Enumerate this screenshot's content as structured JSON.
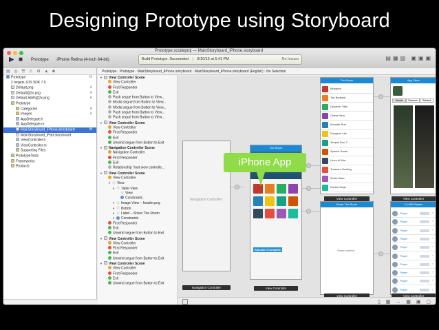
{
  "slide": {
    "title": "Designing Prototype using Storyboard"
  },
  "toolbar": {
    "run_icon": "play-icon",
    "stop_icon": "stop-icon",
    "scheme_target": "Prototype",
    "scheme_device": "iPhone Retina (4-inch 64-bit)",
    "activity_status": "Build Prototype: Succeeded",
    "activity_time": "9/10/13 at 5:41 PM",
    "activity_issues": "No Issues",
    "window_title": "Prototype.xcodeproj — MainStoryboard_iPhone.storyboard"
  },
  "jump_bar": {
    "crumbs": [
      "Prototype",
      "Prototype",
      "MainStoryboard_iPhone.storyboard",
      "MainStoryboard_iPhone.storyboard (English)",
      "No Selection"
    ]
  },
  "navigator": {
    "files": [
      {
        "label": "Prototype",
        "indent": 0,
        "badge": "M",
        "icon_color": "#4d8fe0",
        "selected": false
      },
      {
        "label": "2 targets, iOS SDK 7.0",
        "indent": 1,
        "badge": "",
        "icon_color": "",
        "selected": false
      },
      {
        "label": "Default.png",
        "indent": 1,
        "badge": "A",
        "icon_color": "#d9d9d9",
        "selected": false
      },
      {
        "label": "Default@2x.png",
        "indent": 1,
        "badge": "A",
        "icon_color": "#d9d9d9",
        "selected": false
      },
      {
        "label": "Default-568h@2x.png",
        "indent": 1,
        "badge": "A",
        "icon_color": "#d9d9d9",
        "selected": false
      },
      {
        "label": "Prototype",
        "indent": 1,
        "badge": "",
        "icon_color": "#e8c35a",
        "selected": false
      },
      {
        "label": "Categories",
        "indent": 2,
        "badge": "A",
        "icon_color": "#e8c35a",
        "selected": false
      },
      {
        "label": "Images",
        "indent": 2,
        "badge": "A",
        "icon_color": "#e8c35a",
        "selected": false
      },
      {
        "label": "AppDelegate.h",
        "indent": 2,
        "badge": "",
        "icon_color": "#b3c7e6",
        "selected": false
      },
      {
        "label": "AppDelegate.m",
        "indent": 2,
        "badge": "",
        "icon_color": "#b3c7e6",
        "selected": false
      },
      {
        "label": "MainStoryboard_iPhone.storyboard",
        "indent": 2,
        "badge": "M",
        "icon_color": "#f2f2f2",
        "selected": true
      },
      {
        "label": "MainStoryboard_iPad.storyboard",
        "indent": 2,
        "badge": "",
        "icon_color": "#f2f2f2",
        "selected": false
      },
      {
        "label": "ViewController.h",
        "indent": 2,
        "badge": "",
        "icon_color": "#b3c7e6",
        "selected": false
      },
      {
        "label": "ViewController.m",
        "indent": 2,
        "badge": "",
        "icon_color": "#b3c7e6",
        "selected": false
      },
      {
        "label": "Supporting Files",
        "indent": 2,
        "badge": "",
        "icon_color": "#e8c35a",
        "selected": false
      },
      {
        "label": "PrototypeTests",
        "indent": 1,
        "badge": "",
        "icon_color": "#e8c35a",
        "selected": false
      },
      {
        "label": "Frameworks",
        "indent": 1,
        "badge": "",
        "icon_color": "#e8c35a",
        "selected": false
      },
      {
        "label": "Products",
        "indent": 1,
        "badge": "",
        "icon_color": "#e8c35a",
        "selected": false
      }
    ]
  },
  "outline": {
    "rows": [
      {
        "label": "View Controller Scene",
        "indent": 0,
        "scene": true,
        "icon_color": ""
      },
      {
        "label": "View Controller",
        "indent": 1,
        "scene": false,
        "icon_color": "#f0a030"
      },
      {
        "label": "First Responder",
        "indent": 1,
        "scene": false,
        "icon_color": "#e84d3d"
      },
      {
        "label": "Exit",
        "indent": 1,
        "scene": false,
        "icon_color": "#4cb84c"
      },
      {
        "label": "Push segue from Button to View...",
        "indent": 1,
        "scene": false,
        "icon_color": "#b0b0b0"
      },
      {
        "label": "Modal segue from Button to View...",
        "indent": 1,
        "scene": false,
        "icon_color": "#b0b0b0"
      },
      {
        "label": "Modal segue from Button to View...",
        "indent": 1,
        "scene": false,
        "icon_color": "#b0b0b0"
      },
      {
        "label": "Push segue from Button to View...",
        "indent": 1,
        "scene": false,
        "icon_color": "#b0b0b0"
      },
      {
        "label": "Push segue from Button to View...",
        "indent": 1,
        "scene": false,
        "icon_color": "#b0b0b0"
      },
      {
        "label": "View Controller Scene",
        "indent": 0,
        "scene": true,
        "icon_color": ""
      },
      {
        "label": "View Controller",
        "indent": 1,
        "scene": false,
        "icon_color": "#f0a030"
      },
      {
        "label": "First Responder",
        "indent": 1,
        "scene": false,
        "icon_color": "#e84d3d"
      },
      {
        "label": "Exit",
        "indent": 1,
        "scene": false,
        "icon_color": "#4cb84c"
      },
      {
        "label": "Unwind segue from Button to Exit",
        "indent": 1,
        "scene": false,
        "icon_color": "#4cb84c"
      },
      {
        "label": "Navigation Controller Scene",
        "indent": 0,
        "scene": true,
        "icon_color": ""
      },
      {
        "label": "Navigation Controller",
        "indent": 1,
        "scene": false,
        "icon_color": "#f0a030"
      },
      {
        "label": "First Responder",
        "indent": 1,
        "scene": false,
        "icon_color": "#e84d3d"
      },
      {
        "label": "Exit",
        "indent": 1,
        "scene": false,
        "icon_color": "#4cb84c"
      },
      {
        "label": "Relationship \"root view controlle...",
        "indent": 1,
        "scene": false,
        "icon_color": "#b0b0b0"
      },
      {
        "label": "View Controller Scene",
        "indent": 0,
        "scene": true,
        "icon_color": ""
      },
      {
        "label": "View Controller",
        "indent": 1,
        "scene": false,
        "icon_color": "#f0a030"
      },
      {
        "label": "View",
        "indent": 2,
        "scene": false,
        "icon_color": "#e6e6e6"
      },
      {
        "label": "Table View",
        "indent": 3,
        "scene": false,
        "icon_color": "#e6e6e6"
      },
      {
        "label": "View",
        "indent": 4,
        "scene": false,
        "icon_color": "#e6e6e6"
      },
      {
        "label": "Constraints",
        "indent": 4,
        "scene": false,
        "icon_color": "#5b8fd6"
      },
      {
        "label": "Image View – header.png",
        "indent": 3,
        "scene": false,
        "icon_color": "#e6e6e6"
      },
      {
        "label": "Button",
        "indent": 3,
        "scene": false,
        "icon_color": "#e6e6e6"
      },
      {
        "label": "Label – Share The Room",
        "indent": 3,
        "scene": false,
        "icon_color": "#e6e6e6"
      },
      {
        "label": "Constraints",
        "indent": 3,
        "scene": false,
        "icon_color": "#5b8fd6"
      },
      {
        "label": "First Responder",
        "indent": 1,
        "scene": false,
        "icon_color": "#e84d3d"
      },
      {
        "label": "Exit",
        "indent": 1,
        "scene": false,
        "icon_color": "#4cb84c"
      },
      {
        "label": "Unwind segue from Button to Exit",
        "indent": 1,
        "scene": false,
        "icon_color": "#4cb84c"
      },
      {
        "label": "View Controller Scene",
        "indent": 0,
        "scene": true,
        "icon_color": ""
      },
      {
        "label": "View Controller",
        "indent": 1,
        "scene": false,
        "icon_color": "#f0a030"
      },
      {
        "label": "First Responder",
        "indent": 1,
        "scene": false,
        "icon_color": "#e84d3d"
      },
      {
        "label": "Exit",
        "indent": 1,
        "scene": false,
        "icon_color": "#4cb84c"
      },
      {
        "label": "Unwind segue from Button to Exit",
        "indent": 1,
        "scene": false,
        "icon_color": "#4cb84c"
      },
      {
        "label": "View Controller Scene",
        "indent": 0,
        "scene": true,
        "icon_color": ""
      },
      {
        "label": "View Controller",
        "indent": 1,
        "scene": false,
        "icon_color": "#f0a030"
      },
      {
        "label": "First Responder",
        "indent": 1,
        "scene": false,
        "icon_color": "#e84d3d"
      },
      {
        "label": "Exit",
        "indent": 1,
        "scene": false,
        "icon_color": "#4cb84c"
      },
      {
        "label": "Unwind segue from Button to Exit",
        "indent": 1,
        "scene": false,
        "icon_color": "#4cb84c"
      }
    ]
  },
  "canvas": {
    "callout": "iPhone App",
    "navigation_controller_label": "Navigation Controller",
    "scene_labels": {
      "nav": "Navigation Controller",
      "main": "View Controller",
      "top_list": "View Controller",
      "app_store": "View Controller",
      "share": "View Controller",
      "players": "View Controller"
    },
    "main_header": "The Room",
    "top_list_header": "The Room",
    "app_store_header": "App Store",
    "share_header": "Share The Room",
    "share_body": "Share content",
    "players_header": "10,485 Players",
    "top_list_items": [
      "Blueprint",
      "Tim Burbank",
      "Dynamic Tiles",
      "Chess Hero",
      "Monster Run",
      "Dungeon Life",
      "Temple Run 2",
      "Special Game",
      "Lines of War",
      "Treasure Hunting",
      "World Wars",
      "Rocket Ninja"
    ],
    "app_store_tabs": [
      "Details",
      "Reviews",
      "Related"
    ],
    "players_names": [
      "Player",
      "Player",
      "Player",
      "Player",
      "Player",
      "Player",
      "Player",
      "Player",
      "Player",
      "Player"
    ],
    "main_featured": "Episode 3 Complete",
    "colors": {
      "accent_blue": "#1a8ad6",
      "callout_green": "#8fdc48",
      "selection": "#3b73d9"
    }
  }
}
